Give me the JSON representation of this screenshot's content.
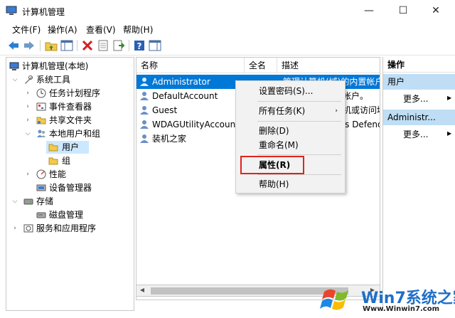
{
  "window": {
    "title": "计算机管理",
    "minimize": "—",
    "maximize": "☐",
    "close": "✕"
  },
  "menu": {
    "file": "文件(F)",
    "action": "操作(A)",
    "view": "查看(V)",
    "help": "帮助(H)"
  },
  "toolbar": {
    "icons": [
      "back-arrow-icon",
      "forward-arrow-icon",
      "up-folder-icon",
      "show-hide-tree-icon",
      "delete-icon",
      "properties-icon",
      "export-list-icon",
      "help-icon",
      "panel-icon"
    ]
  },
  "tree": {
    "root": "计算机管理(本地)",
    "system_tools": "系统工具",
    "task_scheduler": "任务计划程序",
    "event_viewer": "事件查看器",
    "shared_folders": "共享文件夹",
    "local_users_groups": "本地用户和组",
    "users": "用户",
    "groups": "组",
    "performance": "性能",
    "device_manager": "设备管理器",
    "storage": "存储",
    "disk_management": "磁盘管理",
    "services_apps": "服务和应用程序"
  },
  "list": {
    "headers": {
      "name": "名称",
      "fullname": "全名",
      "desc": "描述"
    },
    "rows": [
      {
        "name": "Administrator",
        "desc": "管理计算机(域)的内置帐户"
      },
      {
        "name": "DefaultAccount",
        "desc": "系统管理的用户帐户。"
      },
      {
        "name": "Guest",
        "desc": "供来宾访问计算机或访问域"
      },
      {
        "name": "WDAGUtilityAccount",
        "desc": "系统为 Windows Defender"
      },
      {
        "name": "装机之家",
        "desc": ""
      }
    ]
  },
  "actions": {
    "title": "操作",
    "group1": "用户",
    "more1": "更多...",
    "group2": "Administr...",
    "more2": "更多..."
  },
  "context_menu": {
    "set_password": "设置密码(S)...",
    "all_tasks": "所有任务(K)",
    "delete": "删除(D)",
    "rename": "重命名(M)",
    "properties": "属性(R)",
    "help": "帮助(H)"
  },
  "watermark": {
    "brand": "Win7系统之家",
    "url": "Www.Winwin7.com"
  },
  "colors": {
    "selection": "#0078d7",
    "tree_selection": "#cce8ff",
    "action_group": "#bfdef5",
    "highlight_box": "#e0241c"
  }
}
